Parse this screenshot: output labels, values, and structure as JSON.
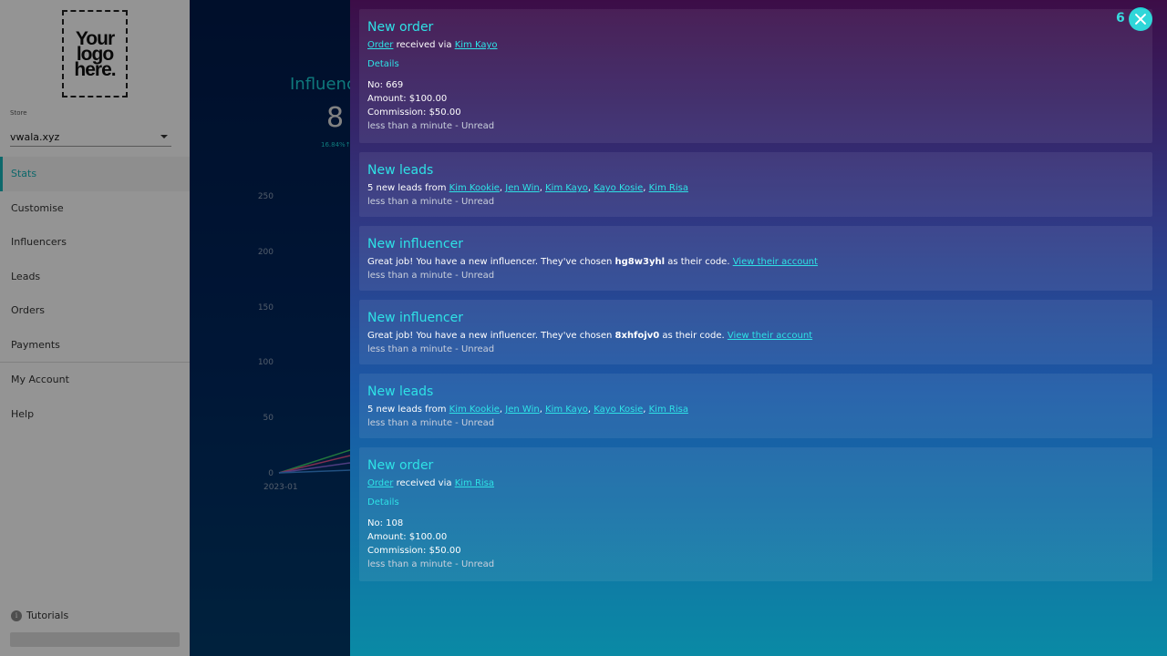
{
  "sidebar": {
    "logo_text": "Your\nlogo\nhere.",
    "store_label": "Store",
    "store_value": "vwala.xyz",
    "nav": [
      "Stats",
      "Customise",
      "Influencers",
      "Leads",
      "Orders",
      "Payments",
      "My Account",
      "Help"
    ],
    "tutorials_label": "Tutorials"
  },
  "main": {
    "title": "Influenc",
    "number": "8",
    "delta": "16.84%↑",
    "y_ticks": [
      "250",
      "200",
      "150",
      "100",
      "50",
      "0"
    ],
    "x_tick": "2023-01"
  },
  "notifications": {
    "count": "6",
    "items": [
      {
        "title": "New order",
        "order_link": "Order",
        "received_via": " received via ",
        "influencer": "Kim Kayo",
        "details": "Details",
        "no": "No: 669",
        "amount": "Amount: $100.00",
        "commission": "Commission: $50.00",
        "meta": "less than a minute - Unread"
      },
      {
        "title": "New leads",
        "prefix": "5 new leads from ",
        "names": [
          "Kim Kookie",
          "Jen Win",
          "Kim Kayo",
          "Kayo Kosie",
          "Kim Risa"
        ],
        "meta": "less than a minute - Unread"
      },
      {
        "title": "New influencer",
        "text_before": "Great job! You have a new influencer. They've chosen ",
        "code": "hg8w3yhl",
        "text_after": " as their code. ",
        "link": "View their account",
        "meta": "less than a minute - Unread"
      },
      {
        "title": "New influencer",
        "text_before": "Great job! You have a new influencer. They've chosen ",
        "code": "8xhfojv0",
        "text_after": " as their code. ",
        "link": "View their account",
        "meta": "less than a minute - Unread"
      },
      {
        "title": "New leads",
        "prefix": "5 new leads from ",
        "names": [
          "Kim Kookie",
          "Jen Win",
          "Kim Kayo",
          "Kayo Kosie",
          "Kim Risa"
        ],
        "meta": "less than a minute - Unread"
      },
      {
        "title": "New order",
        "order_link": "Order",
        "received_via": " received via ",
        "influencer": "Kim Risa",
        "details": "Details",
        "no": "No: 108",
        "amount": "Amount: $100.00",
        "commission": "Commission: $50.00",
        "meta": "less than a minute - Unread"
      }
    ]
  },
  "colors": {
    "accent": "#2ee2e6",
    "panel_top": "#3c0d47",
    "panel_bottom": "#0a8aa5"
  }
}
